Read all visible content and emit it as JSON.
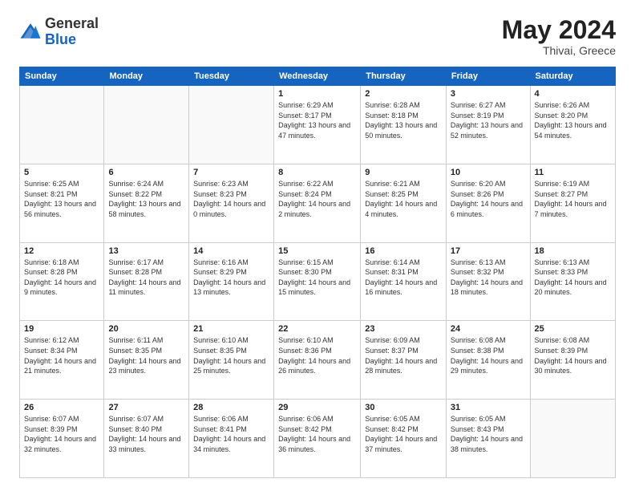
{
  "header": {
    "logo": {
      "general": "General",
      "blue": "Blue"
    },
    "month": "May 2024",
    "location": "Thivai, Greece"
  },
  "weekdays": [
    "Sunday",
    "Monday",
    "Tuesday",
    "Wednesday",
    "Thursday",
    "Friday",
    "Saturday"
  ],
  "weeks": [
    [
      {
        "day": "",
        "sunrise": "",
        "sunset": "",
        "daylight": ""
      },
      {
        "day": "",
        "sunrise": "",
        "sunset": "",
        "daylight": ""
      },
      {
        "day": "",
        "sunrise": "",
        "sunset": "",
        "daylight": ""
      },
      {
        "day": "1",
        "sunrise": "Sunrise: 6:29 AM",
        "sunset": "Sunset: 8:17 PM",
        "daylight": "Daylight: 13 hours and 47 minutes."
      },
      {
        "day": "2",
        "sunrise": "Sunrise: 6:28 AM",
        "sunset": "Sunset: 8:18 PM",
        "daylight": "Daylight: 13 hours and 50 minutes."
      },
      {
        "day": "3",
        "sunrise": "Sunrise: 6:27 AM",
        "sunset": "Sunset: 8:19 PM",
        "daylight": "Daylight: 13 hours and 52 minutes."
      },
      {
        "day": "4",
        "sunrise": "Sunrise: 6:26 AM",
        "sunset": "Sunset: 8:20 PM",
        "daylight": "Daylight: 13 hours and 54 minutes."
      }
    ],
    [
      {
        "day": "5",
        "sunrise": "Sunrise: 6:25 AM",
        "sunset": "Sunset: 8:21 PM",
        "daylight": "Daylight: 13 hours and 56 minutes."
      },
      {
        "day": "6",
        "sunrise": "Sunrise: 6:24 AM",
        "sunset": "Sunset: 8:22 PM",
        "daylight": "Daylight: 13 hours and 58 minutes."
      },
      {
        "day": "7",
        "sunrise": "Sunrise: 6:23 AM",
        "sunset": "Sunset: 8:23 PM",
        "daylight": "Daylight: 14 hours and 0 minutes."
      },
      {
        "day": "8",
        "sunrise": "Sunrise: 6:22 AM",
        "sunset": "Sunset: 8:24 PM",
        "daylight": "Daylight: 14 hours and 2 minutes."
      },
      {
        "day": "9",
        "sunrise": "Sunrise: 6:21 AM",
        "sunset": "Sunset: 8:25 PM",
        "daylight": "Daylight: 14 hours and 4 minutes."
      },
      {
        "day": "10",
        "sunrise": "Sunrise: 6:20 AM",
        "sunset": "Sunset: 8:26 PM",
        "daylight": "Daylight: 14 hours and 6 minutes."
      },
      {
        "day": "11",
        "sunrise": "Sunrise: 6:19 AM",
        "sunset": "Sunset: 8:27 PM",
        "daylight": "Daylight: 14 hours and 7 minutes."
      }
    ],
    [
      {
        "day": "12",
        "sunrise": "Sunrise: 6:18 AM",
        "sunset": "Sunset: 8:28 PM",
        "daylight": "Daylight: 14 hours and 9 minutes."
      },
      {
        "day": "13",
        "sunrise": "Sunrise: 6:17 AM",
        "sunset": "Sunset: 8:28 PM",
        "daylight": "Daylight: 14 hours and 11 minutes."
      },
      {
        "day": "14",
        "sunrise": "Sunrise: 6:16 AM",
        "sunset": "Sunset: 8:29 PM",
        "daylight": "Daylight: 14 hours and 13 minutes."
      },
      {
        "day": "15",
        "sunrise": "Sunrise: 6:15 AM",
        "sunset": "Sunset: 8:30 PM",
        "daylight": "Daylight: 14 hours and 15 minutes."
      },
      {
        "day": "16",
        "sunrise": "Sunrise: 6:14 AM",
        "sunset": "Sunset: 8:31 PM",
        "daylight": "Daylight: 14 hours and 16 minutes."
      },
      {
        "day": "17",
        "sunrise": "Sunrise: 6:13 AM",
        "sunset": "Sunset: 8:32 PM",
        "daylight": "Daylight: 14 hours and 18 minutes."
      },
      {
        "day": "18",
        "sunrise": "Sunrise: 6:13 AM",
        "sunset": "Sunset: 8:33 PM",
        "daylight": "Daylight: 14 hours and 20 minutes."
      }
    ],
    [
      {
        "day": "19",
        "sunrise": "Sunrise: 6:12 AM",
        "sunset": "Sunset: 8:34 PM",
        "daylight": "Daylight: 14 hours and 21 minutes."
      },
      {
        "day": "20",
        "sunrise": "Sunrise: 6:11 AM",
        "sunset": "Sunset: 8:35 PM",
        "daylight": "Daylight: 14 hours and 23 minutes."
      },
      {
        "day": "21",
        "sunrise": "Sunrise: 6:10 AM",
        "sunset": "Sunset: 8:35 PM",
        "daylight": "Daylight: 14 hours and 25 minutes."
      },
      {
        "day": "22",
        "sunrise": "Sunrise: 6:10 AM",
        "sunset": "Sunset: 8:36 PM",
        "daylight": "Daylight: 14 hours and 26 minutes."
      },
      {
        "day": "23",
        "sunrise": "Sunrise: 6:09 AM",
        "sunset": "Sunset: 8:37 PM",
        "daylight": "Daylight: 14 hours and 28 minutes."
      },
      {
        "day": "24",
        "sunrise": "Sunrise: 6:08 AM",
        "sunset": "Sunset: 8:38 PM",
        "daylight": "Daylight: 14 hours and 29 minutes."
      },
      {
        "day": "25",
        "sunrise": "Sunrise: 6:08 AM",
        "sunset": "Sunset: 8:39 PM",
        "daylight": "Daylight: 14 hours and 30 minutes."
      }
    ],
    [
      {
        "day": "26",
        "sunrise": "Sunrise: 6:07 AM",
        "sunset": "Sunset: 8:39 PM",
        "daylight": "Daylight: 14 hours and 32 minutes."
      },
      {
        "day": "27",
        "sunrise": "Sunrise: 6:07 AM",
        "sunset": "Sunset: 8:40 PM",
        "daylight": "Daylight: 14 hours and 33 minutes."
      },
      {
        "day": "28",
        "sunrise": "Sunrise: 6:06 AM",
        "sunset": "Sunset: 8:41 PM",
        "daylight": "Daylight: 14 hours and 34 minutes."
      },
      {
        "day": "29",
        "sunrise": "Sunrise: 6:06 AM",
        "sunset": "Sunset: 8:42 PM",
        "daylight": "Daylight: 14 hours and 36 minutes."
      },
      {
        "day": "30",
        "sunrise": "Sunrise: 6:05 AM",
        "sunset": "Sunset: 8:42 PM",
        "daylight": "Daylight: 14 hours and 37 minutes."
      },
      {
        "day": "31",
        "sunrise": "Sunrise: 6:05 AM",
        "sunset": "Sunset: 8:43 PM",
        "daylight": "Daylight: 14 hours and 38 minutes."
      },
      {
        "day": "",
        "sunrise": "",
        "sunset": "",
        "daylight": ""
      }
    ]
  ]
}
